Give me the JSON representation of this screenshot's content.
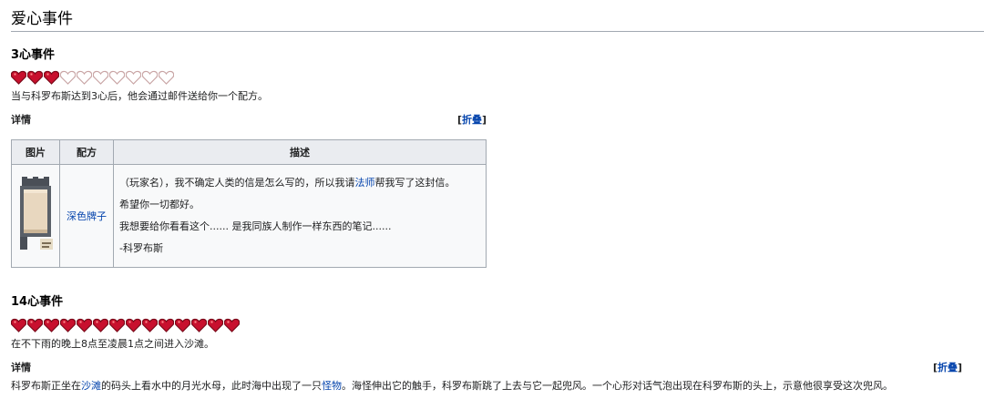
{
  "section": {
    "title": "爱心事件"
  },
  "event3": {
    "heading": "3心事件",
    "hearts_filled": 3,
    "hearts_total": 10,
    "description": "当与科罗布斯达到3心后，他会通过邮件送给你一个配方。",
    "details_label": "详情",
    "toggle_open": "[",
    "toggle_link": "折叠",
    "toggle_close": "]",
    "table": {
      "headers": [
        "图片",
        "配方",
        "描述"
      ],
      "item_name": "深色牌子",
      "letter": {
        "line1_pre": "（玩家名），我不确定人类的信是怎么写的，所以我请",
        "line1_link": "法师",
        "line1_post": "帮我写了这封信。",
        "line2": "希望你一切都好。",
        "line3": "我想要给你看看这个...... 是我同族人制作一样东西的笔记......",
        "line4": "-科罗布斯"
      }
    }
  },
  "event14": {
    "heading": "14心事件",
    "hearts_filled": 14,
    "hearts_total": 14,
    "description": "在不下雨的晚上8点至凌晨1点之间进入沙滩。",
    "details_label": "详情",
    "toggle_open": "[",
    "toggle_link": "折叠",
    "toggle_close": "]",
    "text": {
      "p1": "科罗布斯正坐在",
      "link1": "沙滩",
      "p2": "的码头上看水中的月光水母，此时海中出现了一只",
      "link2": "怪物",
      "p3": "。海怪伸出它的触手，科罗布斯跳了上去与它一起兜风。一个心形对话气泡出现在科罗布斯的头上，示意他很享受这次兜风。"
    }
  },
  "colors": {
    "heart_fill": "#c8102e",
    "heart_dark": "#7a0a1a",
    "heart_empty_outline": "#c9a5a5",
    "link": "#0645ad"
  }
}
